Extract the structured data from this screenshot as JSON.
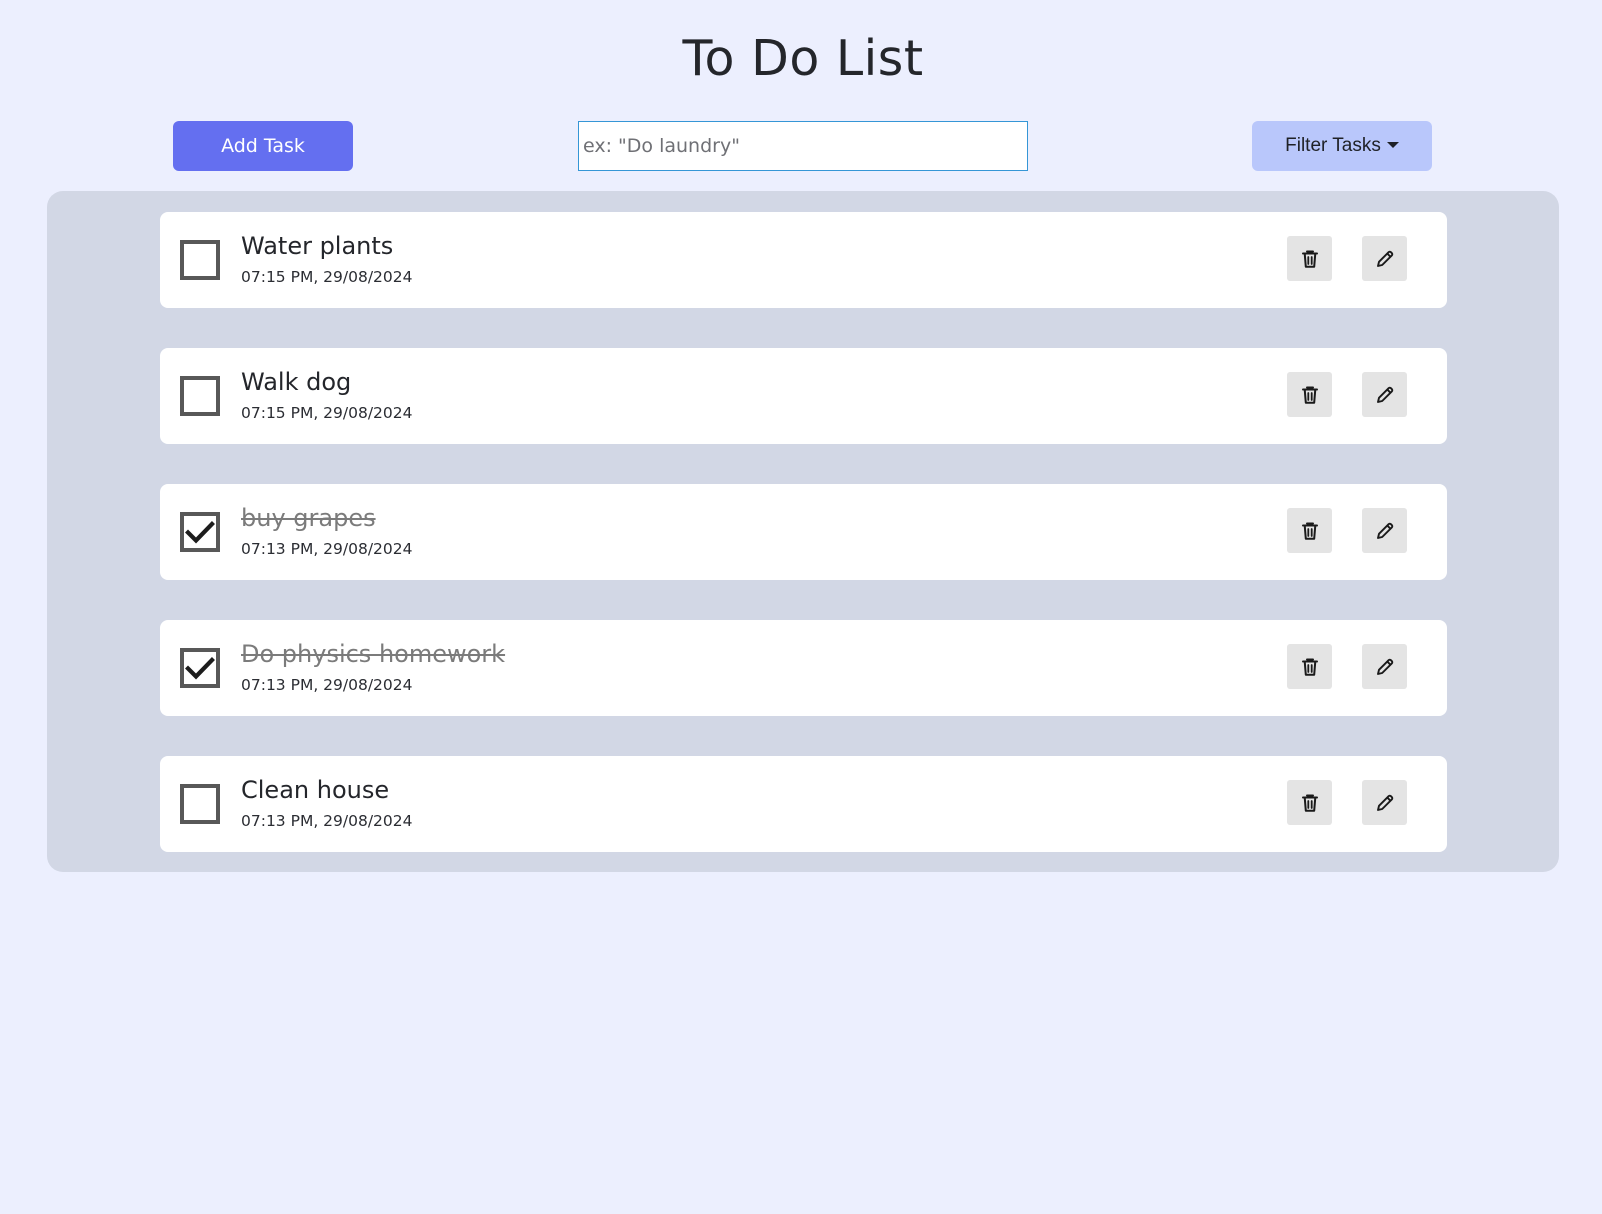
{
  "header": {
    "title": "To Do List"
  },
  "toolbar": {
    "add_label": "Add Task",
    "input_placeholder": "ex: \"Do laundry\"",
    "input_value": "",
    "filter_label": "Filter Tasks"
  },
  "colors": {
    "background": "#eceffe",
    "panel": "#d2d7e5",
    "add_button": "#646ff0",
    "filter_button": "#b9c7fb",
    "input_border": "#3596d6"
  },
  "tasks": [
    {
      "title": "Water plants",
      "time": "07:15 PM, 29/08/2024",
      "completed": false
    },
    {
      "title": "Walk dog",
      "time": "07:15 PM, 29/08/2024",
      "completed": false
    },
    {
      "title": "buy grapes",
      "time": "07:13 PM, 29/08/2024",
      "completed": true
    },
    {
      "title": "Do physics homework",
      "time": "07:13 PM, 29/08/2024",
      "completed": true
    },
    {
      "title": "Clean house",
      "time": "07:13 PM, 29/08/2024",
      "completed": false
    }
  ],
  "icons": {
    "delete": "trash-icon",
    "edit": "pencil-icon",
    "check": "checkmark-icon",
    "dropdown": "caret-down-icon"
  }
}
